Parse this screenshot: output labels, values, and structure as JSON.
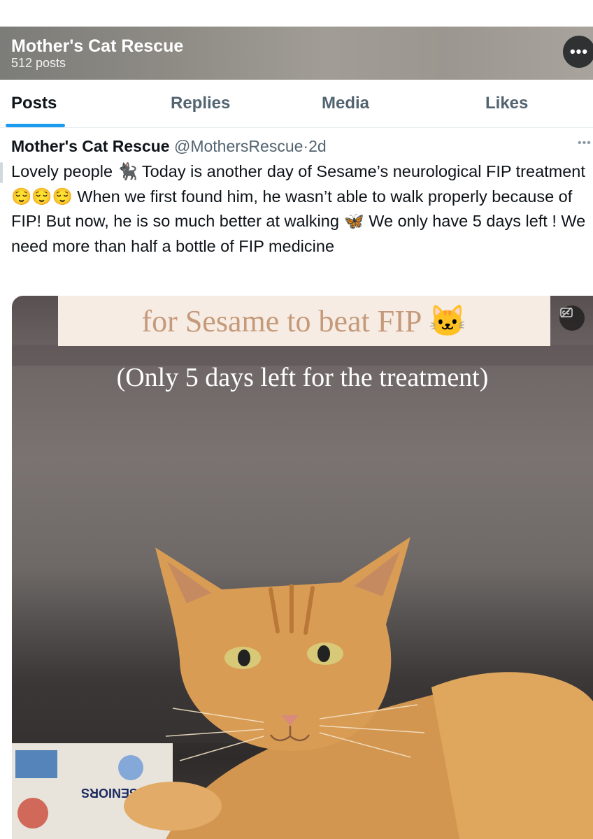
{
  "profile": {
    "name": "Mother's Cat Rescue",
    "post_count": "512 posts",
    "more_label": "•••"
  },
  "tabs": [
    "Posts",
    "Replies",
    "Media",
    "Likes"
  ],
  "active_tab": "Posts",
  "post": {
    "author": "Mother's Cat Rescue",
    "handle": "@MothersRescue",
    "separator": "·",
    "time": "2d",
    "more_label": "•••",
    "text": "Lovely people 🐈‍⬛ Today is another day of Sesame’s neurological FIP treatment 😌😌😌 When we first found him, he wasn’t able to walk properly because of FIP! But now, he is so much better at walking 🦋 We only have 5 days left ! We need more than half a bottle of FIP medicine",
    "media": {
      "caption": "for Sesame to beat FIP 🐱",
      "subcaption": "(Only 5 days left for the treatment)",
      "newspaper_text": "SENIORS"
    }
  },
  "icons": {
    "more": "more-horizontal-icon",
    "captions": "closed-captions-icon"
  },
  "colors": {
    "accent": "#1d9bf0",
    "text_primary": "#0f1419",
    "text_secondary": "#536471",
    "caption_bg": "#f6ece4",
    "caption_text": "#c59a7a",
    "cat_fur": "#d79a52"
  }
}
